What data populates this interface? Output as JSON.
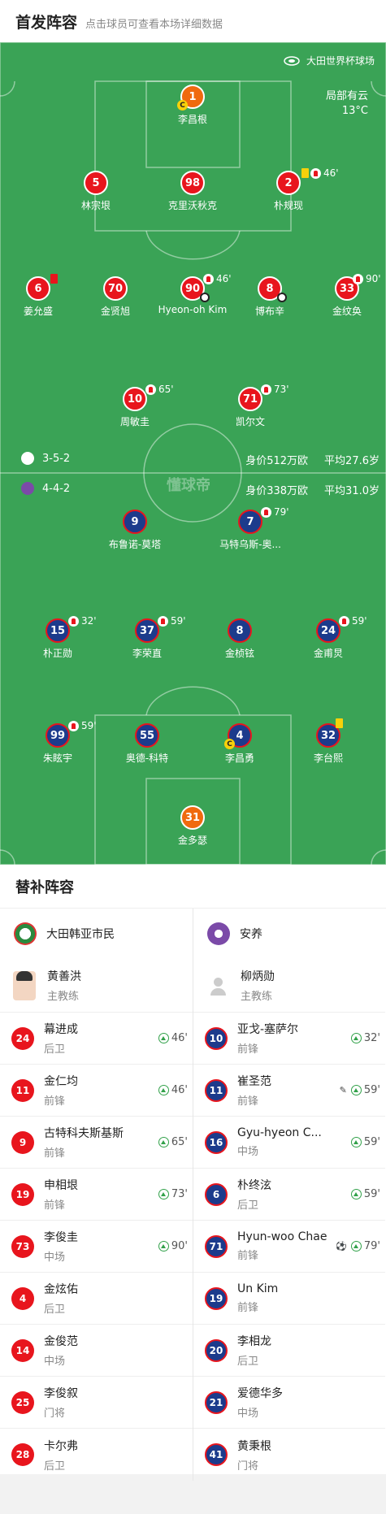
{
  "header": {
    "title": "首发阵容",
    "subtitle": "点击球员可查看本场详细数据"
  },
  "field": {
    "stadium": "大田世界杯球场",
    "weather_line1": "局部有云",
    "weather_line2": "13°C",
    "watermark": "懂球帝"
  },
  "home_team": {
    "formation": "3-5-2",
    "value": "身价512万欧",
    "avg_age": "平均27.6岁"
  },
  "away_team": {
    "formation": "4-4-2",
    "value": "身价338万欧",
    "avg_age": "平均31.0岁"
  },
  "home_players": [
    {
      "num": "1",
      "name": "李昌根",
      "sub": ""
    },
    {
      "num": "5",
      "name": "林宗垠",
      "sub": ""
    },
    {
      "num": "98",
      "name": "克里沃秋克",
      "sub": ""
    },
    {
      "num": "2",
      "name": "朴规现",
      "sub": "46'"
    },
    {
      "num": "6",
      "name": "姜允盛",
      "sub": ""
    },
    {
      "num": "70",
      "name": "金贤旭",
      "sub": ""
    },
    {
      "num": "90",
      "name": "Hyeon-oh Kim",
      "sub": "46'"
    },
    {
      "num": "8",
      "name": "博布辛",
      "sub": ""
    },
    {
      "num": "33",
      "name": "金纹奂",
      "sub": "90'"
    },
    {
      "num": "10",
      "name": "周敏圭",
      "sub": "65'"
    },
    {
      "num": "71",
      "name": "凯尔文",
      "sub": "73'"
    }
  ],
  "away_players": [
    {
      "num": "9",
      "name": "布鲁诺-莫塔",
      "sub": ""
    },
    {
      "num": "7",
      "name": "马特乌斯-奥...",
      "sub": "79'"
    },
    {
      "num": "15",
      "name": "朴正勋",
      "sub": "32'"
    },
    {
      "num": "37",
      "name": "李荣直",
      "sub": "59'"
    },
    {
      "num": "8",
      "name": "金桢铉",
      "sub": ""
    },
    {
      "num": "24",
      "name": "金甫炅",
      "sub": "59'"
    },
    {
      "num": "99",
      "name": "朱眩宇",
      "sub": "59'"
    },
    {
      "num": "55",
      "name": "奥德-科特",
      "sub": ""
    },
    {
      "num": "4",
      "name": "李昌勇",
      "sub": ""
    },
    {
      "num": "32",
      "name": "李台熙",
      "sub": ""
    },
    {
      "num": "31",
      "name": "金多瑟",
      "sub": ""
    }
  ],
  "subs": {
    "title": "替补阵容",
    "home": {
      "team_name": "大田韩亚市民",
      "coach_name": "黄善洪",
      "coach_role": "主教练",
      "players": [
        {
          "num": "24",
          "name": "幕进成",
          "pos": "后卫",
          "in": "46'"
        },
        {
          "num": "11",
          "name": "金仁均",
          "pos": "前锋",
          "in": "46'"
        },
        {
          "num": "9",
          "name": "古特科夫斯基斯",
          "pos": "前锋",
          "in": "65'"
        },
        {
          "num": "19",
          "name": "申相垠",
          "pos": "前锋",
          "in": "73'"
        },
        {
          "num": "73",
          "name": "李俊圭",
          "pos": "中场",
          "in": "90'"
        },
        {
          "num": "4",
          "name": "金炫佑",
          "pos": "后卫",
          "in": ""
        },
        {
          "num": "14",
          "name": "金俊范",
          "pos": "中场",
          "in": ""
        },
        {
          "num": "25",
          "name": "李俊叙",
          "pos": "门将",
          "in": ""
        },
        {
          "num": "28",
          "name": "卡尔弗",
          "pos": "后卫",
          "in": ""
        }
      ]
    },
    "away": {
      "team_name": "安养",
      "coach_name": "柳炳勋",
      "coach_role": "主教练",
      "players": [
        {
          "num": "10",
          "name": "亚戈-塞萨尔",
          "pos": "前锋",
          "in": "32'"
        },
        {
          "num": "11",
          "name": "崔圣范",
          "pos": "前锋",
          "in": "59'"
        },
        {
          "num": "16",
          "name": "Gyu-hyeon C...",
          "pos": "中场",
          "in": "59'"
        },
        {
          "num": "6",
          "name": "朴终泫",
          "pos": "后卫",
          "in": "59'"
        },
        {
          "num": "71",
          "name": "Hyun-woo Chae",
          "pos": "前锋",
          "in": "79'"
        },
        {
          "num": "19",
          "name": "Un Kim",
          "pos": "前锋",
          "in": ""
        },
        {
          "num": "20",
          "name": "李相龙",
          "pos": "后卫",
          "in": ""
        },
        {
          "num": "21",
          "name": "爱德华多",
          "pos": "中场",
          "in": ""
        },
        {
          "num": "41",
          "name": "黄秉根",
          "pos": "门将",
          "in": ""
        }
      ]
    }
  },
  "colors": {
    "pitch": "#3aa356",
    "home": "#e8151d",
    "away": "#1c3b8c",
    "goalkeeper": "#f06a0f"
  }
}
